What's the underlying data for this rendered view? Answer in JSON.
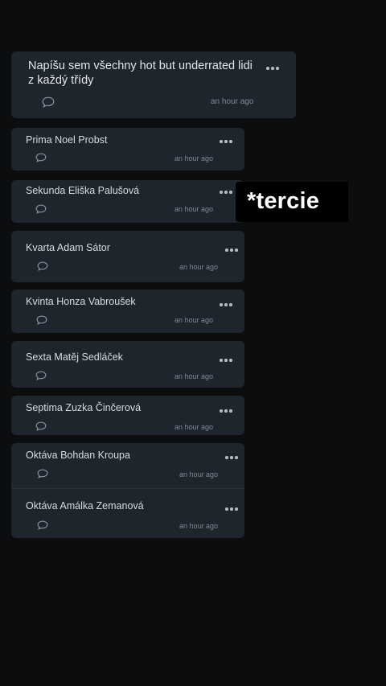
{
  "thread": {
    "title": "Napíšu sem všechny hot but underrated lidi z každý třídy",
    "time": "an hour ago"
  },
  "replies": [
    {
      "text": "Prima Noel Probst",
      "time": "an hour ago"
    },
    {
      "text": "Sekunda Eliška Palušová",
      "time": "an hour ago"
    },
    {
      "text": "Kvarta Adam Sátor",
      "time": "an hour ago"
    },
    {
      "text": "Kvinta Honza Vabroušek",
      "time": "an hour ago"
    },
    {
      "text": "Sexta Matěj Sedláček",
      "time": "an hour ago"
    },
    {
      "text": "Septima Zuzka Činčerová",
      "time": "an hour ago"
    },
    {
      "text": "Oktáva Bohdan Kroupa",
      "time": "an hour ago"
    },
    {
      "text": "Oktáva Amálka Zemanová",
      "time": "an hour ago"
    }
  ],
  "overlay": {
    "text": "*tercie"
  },
  "icons": {
    "comment": "comment-bubble-icon",
    "more": "more-options-icon"
  }
}
